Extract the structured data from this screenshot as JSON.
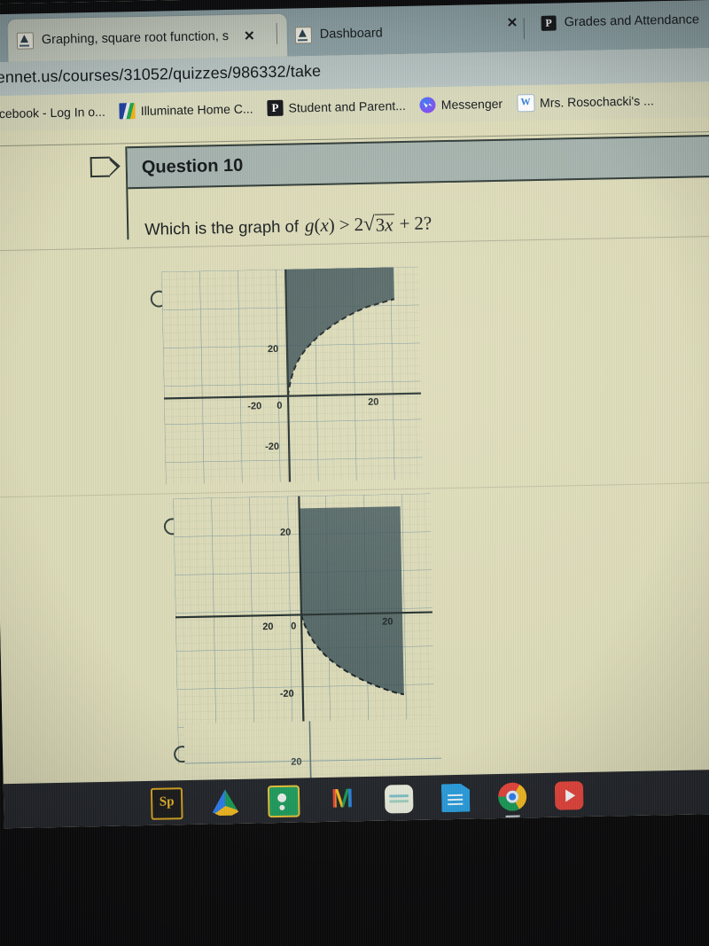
{
  "browser": {
    "tabs": [
      {
        "title": "Graphing, square root function, s",
        "favicon": "canvas-icon",
        "active": true,
        "close_label": "✕"
      },
      {
        "title": "Dashboard",
        "favicon": "canvas-icon",
        "active": false,
        "close_label": "✕"
      },
      {
        "title": "Grades and Attendance",
        "favicon": "powerschool-icon",
        "active": false,
        "close_label": ""
      }
    ],
    "back_chevron": "‹",
    "url": "ennet.us/courses/31052/quizzes/986332/take",
    "bookmarks": [
      {
        "label": "Facebook - Log In o...",
        "icon": "facebook-icon"
      },
      {
        "label": "Illuminate Home C...",
        "icon": "illuminate-icon"
      },
      {
        "label": "Student and Parent...",
        "icon": "powerschool-icon"
      },
      {
        "label": "Messenger",
        "icon": "messenger-icon"
      },
      {
        "label": "Mrs. Rosochacki's ...",
        "icon": "weebly-icon"
      }
    ]
  },
  "quiz": {
    "question_number": "Question 10",
    "flag_icon": "flag-icon",
    "prompt_prefix": "Which is the graph of",
    "math": {
      "function_name": "g",
      "variable": "x",
      "relation": ">",
      "coefficient": "2",
      "radicand_coefficient": "3",
      "radicand_variable": "x",
      "plus": "+",
      "constant": "2",
      "question_mark": "?",
      "radical_sign": "√",
      "full_text": "g(x) > 2√(3x) + 2?"
    },
    "options": [
      {
        "id": "option-a",
        "selected": false,
        "axis_labels": {
          "x_neg": "-20",
          "x_pos": "20",
          "origin": "0",
          "y_pos": "20",
          "y_neg": "-20"
        },
        "description": "Increasing square-root curve opening right from origin; region above/left of curve shaded"
      },
      {
        "id": "option-b",
        "selected": false,
        "axis_labels": {
          "x_neg": "20",
          "x_pos": "20",
          "origin": "0",
          "y_pos": "20",
          "y_neg": "-20"
        },
        "description": "Decreasing square-root curve opening right and downward from origin; region above curve shaded"
      },
      {
        "id": "option-c",
        "selected": false,
        "axis_labels": {
          "y_neg": "20"
        },
        "description": "Third option partially cut off below the visible screen area"
      }
    ]
  },
  "colors": {
    "page_background": "#dedcb9",
    "tabstrip": "#8fa4a8",
    "omnibox": "#b9c6c4",
    "bookmarks_bar": "#d9d9bc",
    "question_header": "#a5b3ae",
    "shaded_region": "#3b5257",
    "grid_line": "#86a0a2",
    "axis_line": "#24302f",
    "shelf": "#23262b",
    "bezel": "#0a0a0c"
  },
  "shelf": {
    "icons": [
      {
        "name": "adobe-spark-icon",
        "label": "Sp"
      },
      {
        "name": "google-drive-icon",
        "label": ""
      },
      {
        "name": "google-classroom-icon",
        "label": ""
      },
      {
        "name": "gmail-icon",
        "label": "M"
      },
      {
        "name": "notes-app-icon",
        "label": ""
      },
      {
        "name": "google-docs-icon",
        "label": ""
      },
      {
        "name": "chrome-icon",
        "label": ""
      },
      {
        "name": "youtube-icon",
        "label": ""
      }
    ]
  }
}
